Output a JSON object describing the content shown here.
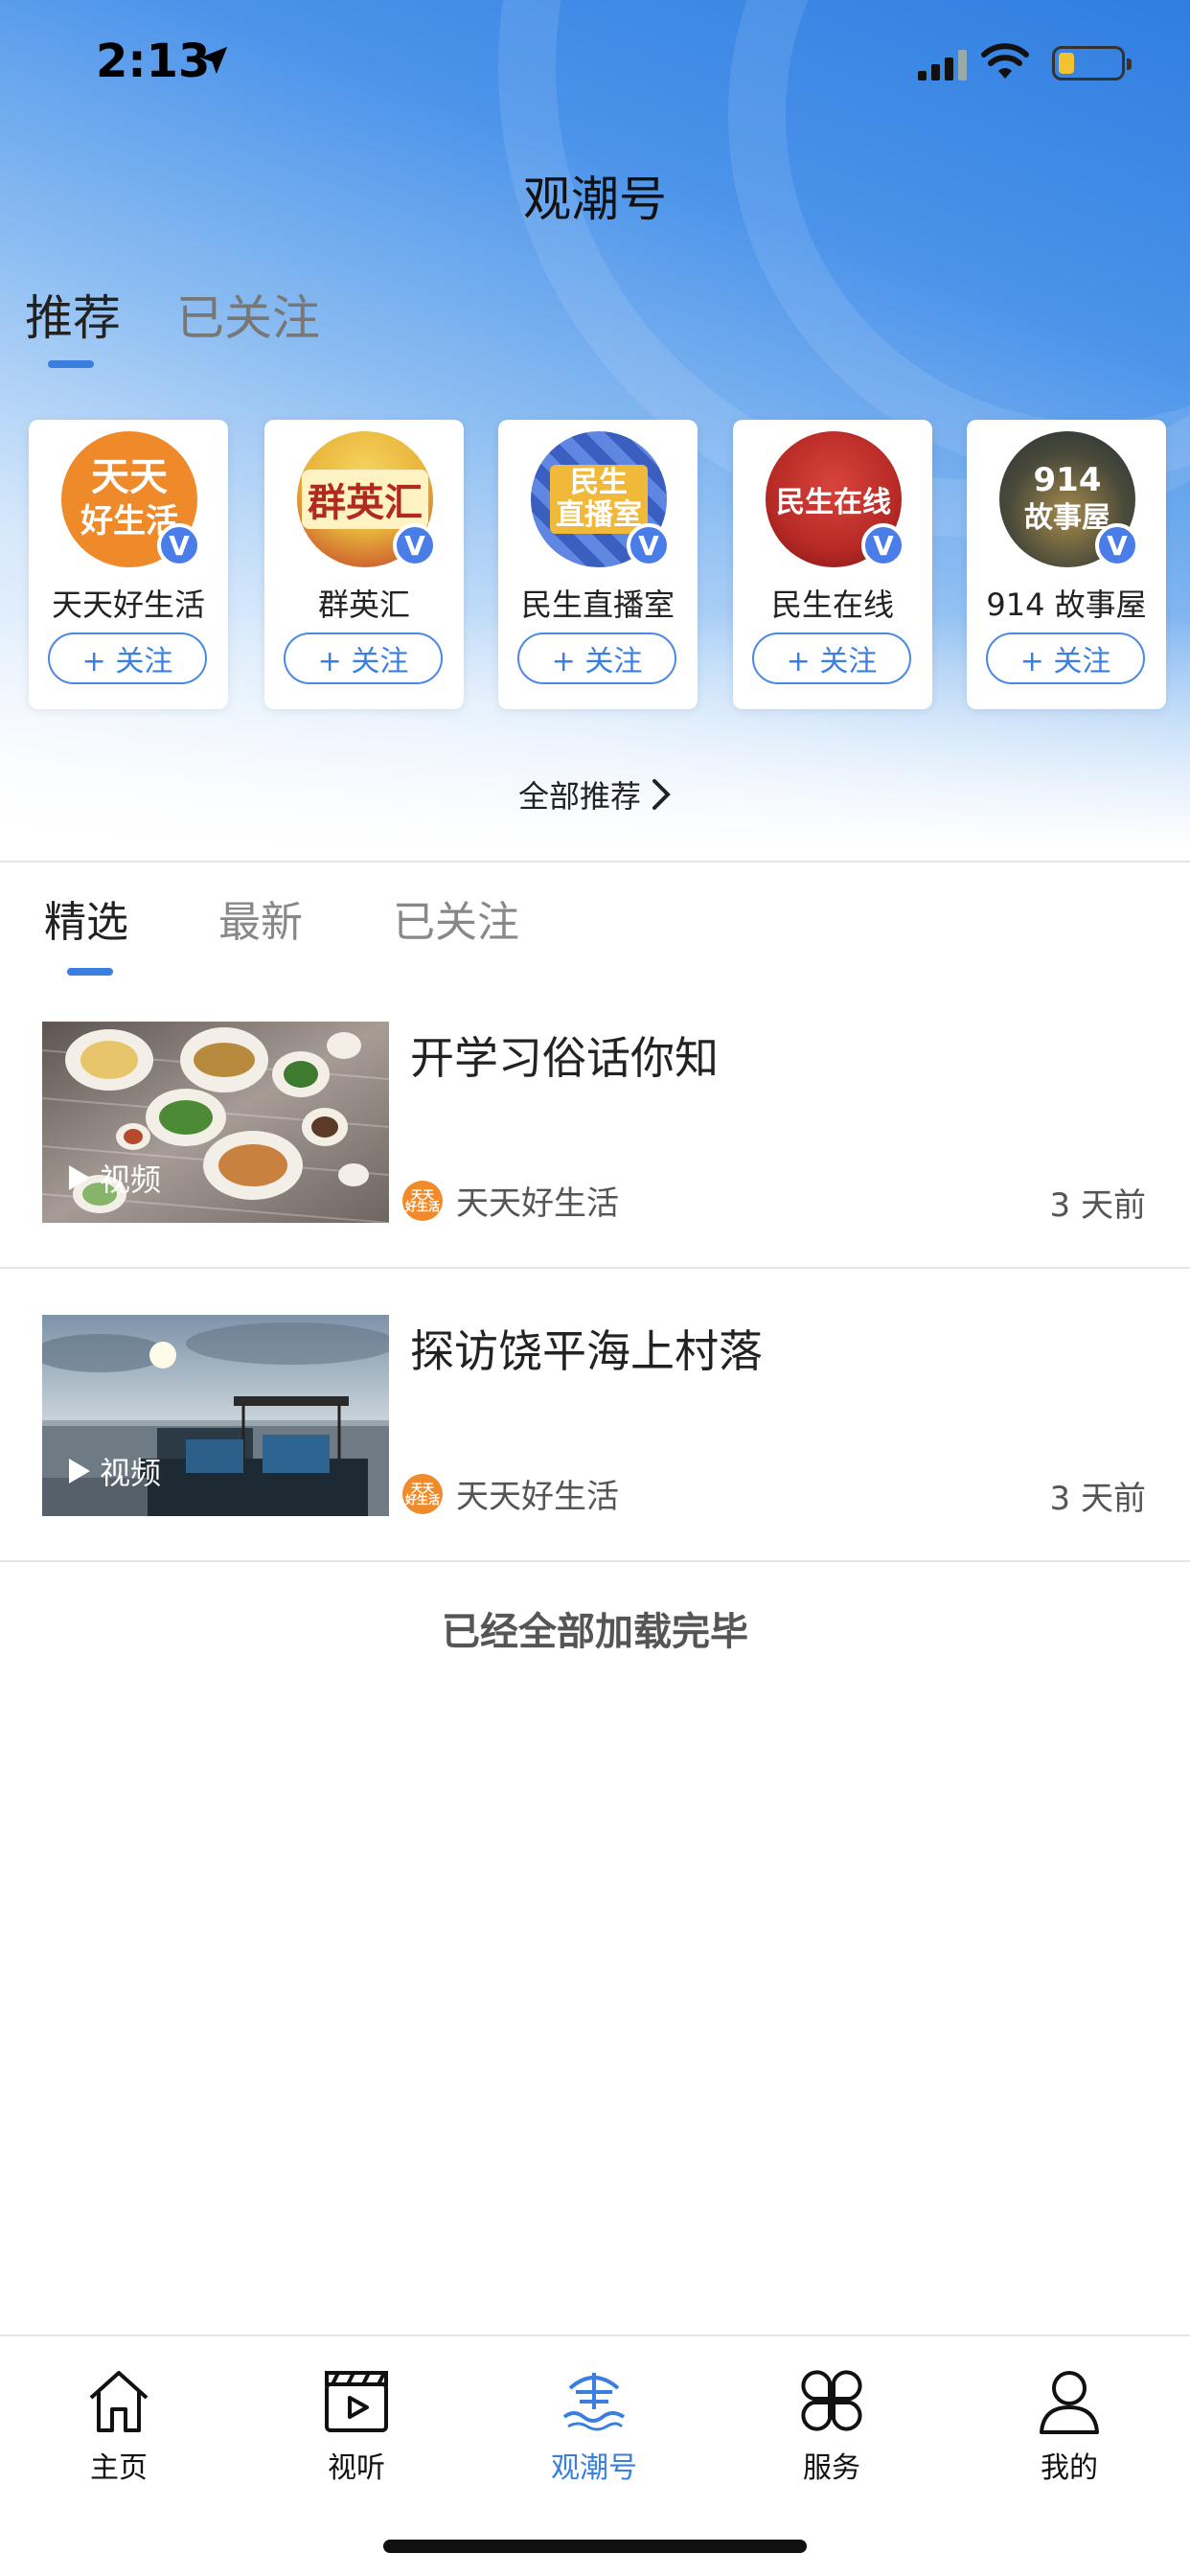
{
  "status_bar": {
    "time": "2:13"
  },
  "header": {
    "title": "观潮号"
  },
  "top_tabs": [
    {
      "label": "推荐",
      "active": true
    },
    {
      "label": "已关注",
      "active": false
    }
  ],
  "recommend": {
    "follow_label": "+ 关注",
    "verified_badge": "V",
    "cards": [
      {
        "name": "天天好生活",
        "logo_text": "天天\n好生活",
        "color": "#ef8a2b"
      },
      {
        "name": "群英汇",
        "logo_text": "群英汇",
        "color": "#e9b43a"
      },
      {
        "name": "民生直播室",
        "logo_text": "民生\n直播室",
        "color": "#4c6fd1"
      },
      {
        "name": "民生在线",
        "logo_text": "民生在线",
        "color": "#b72a26"
      },
      {
        "name": "914 故事屋",
        "logo_text": "914\n故事屋",
        "color": "#2f3a3f"
      }
    ],
    "all_label": "全部推荐"
  },
  "sub_tabs": [
    {
      "label": "精选",
      "active": true
    },
    {
      "label": "最新",
      "active": false
    },
    {
      "label": "已关注",
      "active": false
    }
  ],
  "articles": [
    {
      "title": "开学习俗话你知",
      "tag": "视频",
      "source": "天天好生活",
      "time": "3 天前",
      "source_logo": "天天\n好生活"
    },
    {
      "title": "探访饶平海上村落",
      "tag": "视频",
      "source": "天天好生活",
      "time": "3 天前",
      "source_logo": "天天\n好生活"
    }
  ],
  "end_note": "已经全部加载完毕",
  "bottom_nav": [
    {
      "label": "主页",
      "icon": "home-icon",
      "active": false
    },
    {
      "label": "视听",
      "icon": "clapperboard-icon",
      "active": false
    },
    {
      "label": "观潮号",
      "icon": "tide-icon",
      "active": true
    },
    {
      "label": "服务",
      "icon": "clover-icon",
      "active": false
    },
    {
      "label": "我的",
      "icon": "user-icon",
      "active": false
    }
  ],
  "colors": {
    "accent": "#3a7fe0",
    "badge": "#4a7de8"
  }
}
